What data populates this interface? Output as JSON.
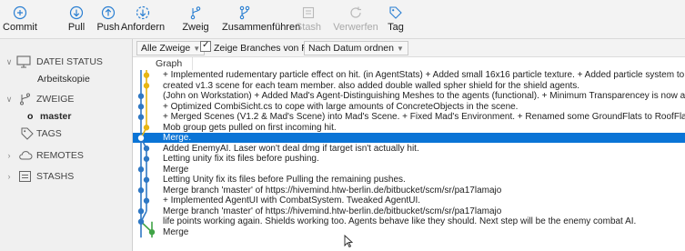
{
  "toolbar": {
    "commit": "Commit",
    "pull": "Pull",
    "push": "Push",
    "fetch": "Anfordern",
    "branch": "Zweig",
    "merge": "Zusammenführen",
    "stash": "Stash",
    "discard": "Verwerfen",
    "tag": "Tag"
  },
  "sidebar": {
    "file_status": "DATEI STATUS",
    "working_copy": "Arbeitskopie",
    "branches": "ZWEIGE",
    "current_branch_marker": "o",
    "master": "master",
    "tags": "TAGS",
    "remotes": "REMOTES",
    "stashes": "STASHS"
  },
  "filters": {
    "all_branches": "Alle Zweige",
    "show_remote": "Zeige Branches von Remote",
    "sort": "Nach Datum ordnen"
  },
  "graph_header": "Graph",
  "commits": [
    "+ Implemented rudementary particle effect on hit. (in AgentStats) + Added small 16x16 particle texture. + Added particle system to every agent.",
    "created v1.3 scene for each team member. also added double walled spher shield for the shield agents.",
    "(John on Workstation) + Added Mad's Agent-Distinguishing Meshes to the agents (functional). + Minimum Transparencey is now adjustable in CombiSicht",
    "+ Optimized CombiSicht.cs to cope with large amounts of ConcreteObjects in the scene.",
    "+ Merged Scenes (V1.2 & Mad's Scene) into Mad's Scene. + Fixed Mad's Environment. + Renamed some GroundFlats to RoofFlats and some BLocks to walk",
    "Mob group gets pulled on first incoming hit.",
    "Merge.",
    "Added EnemyAI. Laser won't deal dmg if target isn't actually hit.",
    "Letting unity fix its files before pushing.",
    "Merge",
    "Letting Unity fix its files before Pulling the remaining pushes.",
    "Merge branch 'master' of https://hivemind.htw-berlin.de/bitbucket/scm/sr/pa17lamajo",
    "+ Implemented AgentUI with CombatSystem. Tweaked AgentUI.",
    "Merge branch 'master' of https://hivemind.htw-berlin.de/bitbucket/scm/sr/pa17lamajo",
    "life points working again. Shields working too. Agents behave like they should. Next step will be the enemy combat AI.",
    "Merge"
  ],
  "selected_commit_index": 6,
  "colors": {
    "selection": "#0a74d6",
    "lane_blue": "#2f78c4",
    "lane_yellow": "#e7b512",
    "lane_green": "#41a447",
    "accent": "#2a7fd2"
  }
}
